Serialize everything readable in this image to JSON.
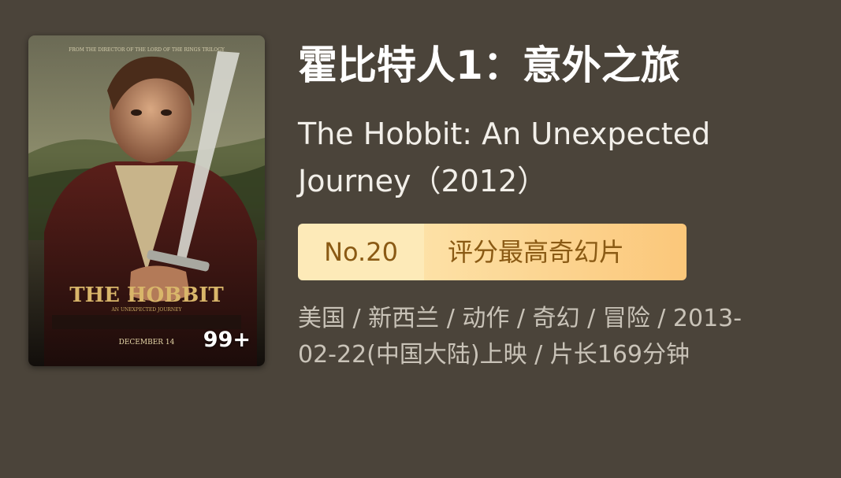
{
  "poster": {
    "tagline": "FROM THE DIRECTOR OF THE LORD OF THE RINGS TRILOGY",
    "logo_text": "THE HOBBIT",
    "logo_subtitle": "AN UNEXPECTED JOURNEY",
    "date_text": "DECEMBER 14",
    "badge": "99+"
  },
  "movie": {
    "title_cn": "霍比特人1：意外之旅",
    "title_en": "The Hobbit: An Unexpected Journey（2012）",
    "meta": "美国 / 新西兰 / 动作 / 奇幻 / 冒险 / 2013-02-22(中国大陆)上映 / 片长169分钟"
  },
  "ranking": {
    "number": "No.20",
    "label": "评分最高奇幻片"
  },
  "colors": {
    "background": "#4b443a",
    "badge_left": "#fdeab8",
    "badge_right": "#fbc77a",
    "badge_text": "#8a5a14"
  }
}
